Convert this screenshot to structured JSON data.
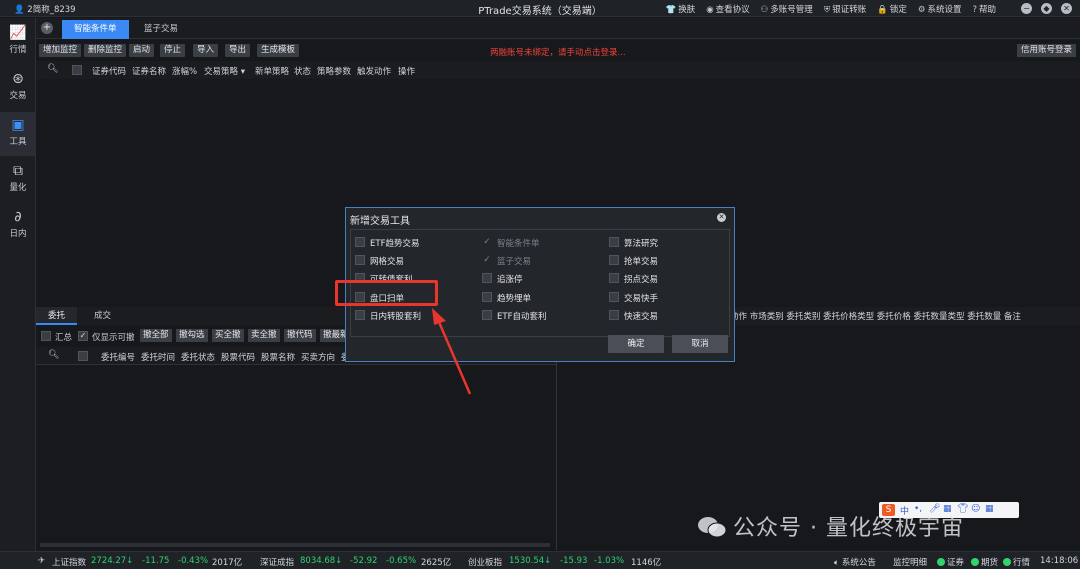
{
  "titlebar": {
    "user": "2简称_8239",
    "title": "PTrade交易系统（交易端）",
    "menu": [
      "换肤",
      "查看协议",
      "多账号管理",
      "银证转账",
      "锁定",
      "系统设置",
      "帮助"
    ]
  },
  "nav": [
    {
      "label": "行情",
      "icon": "chart-icon"
    },
    {
      "label": "交易",
      "icon": "yen-icon"
    },
    {
      "label": "工具",
      "icon": "toolbox-icon",
      "active": true
    },
    {
      "label": "量化",
      "icon": "quant-icon"
    },
    {
      "label": "日内",
      "icon": "intraday-icon"
    }
  ],
  "tabs": [
    "智能条件单",
    "篮子交易"
  ],
  "toolbar": {
    "buttons": [
      "增加监控",
      "删除监控",
      "启动",
      "停止",
      "导入",
      "导出",
      "生成模板"
    ],
    "warning": "两融账号未绑定，请手动点击登录...",
    "credit_login": "信用账号登录"
  },
  "table_headers": [
    "证券代码",
    "证券名称",
    "涨幅%",
    "交易策略 ▾",
    "新单策略",
    "状态",
    "策略参数",
    "触发动作",
    "操作"
  ],
  "lower": {
    "tabs": [
      "委托",
      "成交"
    ],
    "summary_label": "汇总",
    "only_cancelable_label": "仅显示可撤",
    "actions": [
      "撤全部",
      "撤勾选",
      "买全撤",
      "卖全撤",
      "撤代码",
      "撤最新"
    ],
    "headers": [
      "委托编号",
      "委托时间",
      "委托状态",
      "股票代码",
      "股票名称",
      "买卖方向",
      "委"
    ],
    "right_headers": "动作  市场类别  委托类别  委托价格类型  委托价格  委托数量类型  委托数量  备注"
  },
  "modal": {
    "title": "新增交易工具",
    "col1": [
      {
        "label": "ETF趋势交易"
      },
      {
        "label": "网格交易"
      },
      {
        "label": "可转债套利"
      },
      {
        "label": "盘口扫单"
      },
      {
        "label": "日内转股套利"
      }
    ],
    "col2": [
      {
        "label": "智能条件单",
        "disabled": true
      },
      {
        "label": "篮子交易",
        "disabled": true
      },
      {
        "label": "追涨停"
      },
      {
        "label": "趋势埋单"
      },
      {
        "label": "ETF自动套利"
      }
    ],
    "col3": [
      {
        "label": "算法研究"
      },
      {
        "label": "抢单交易"
      },
      {
        "label": "拐点交易"
      },
      {
        "label": "交易快手"
      },
      {
        "label": "快速交易"
      }
    ],
    "confirm": "确定",
    "cancel": "取消"
  },
  "statusbar": {
    "idx1": {
      "name": "上证指数",
      "value": "2724.27",
      "arrow": "↓",
      "chg": "-11.75",
      "pct": "-0.43%",
      "vol": "2017亿"
    },
    "idx2": {
      "name": "深证成指",
      "value": "8034.68",
      "arrow": "↓",
      "chg": "-52.92",
      "pct": "-0.65%",
      "vol": "2625亿"
    },
    "idx3": {
      "name": "创业板指",
      "value": "1530.54",
      "arrow": "↓",
      "chg": "-15.93",
      "pct": "-1.03%",
      "vol": "1146亿"
    },
    "notice": "系统公告",
    "monitor": "监控明细",
    "lights": [
      "证券",
      "期货",
      "行情"
    ],
    "time": "14:18:06"
  },
  "watermark": "公众号 · 量化终极宇宙",
  "ime": "中"
}
